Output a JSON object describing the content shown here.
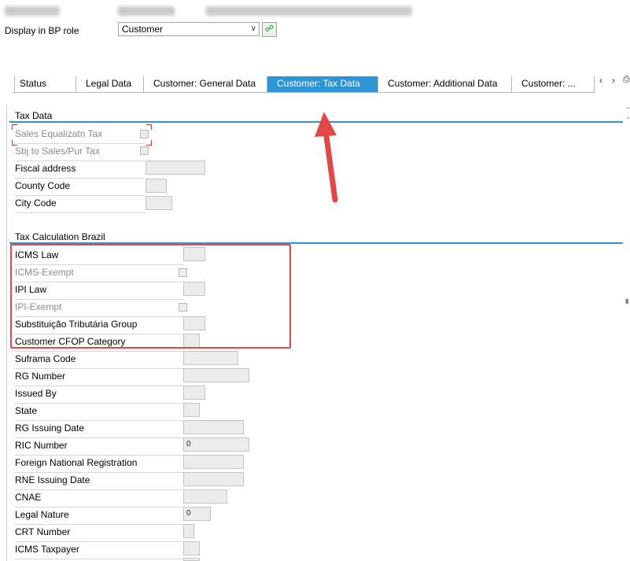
{
  "header": {
    "role_label": "Display in BP role",
    "role_value": "Customer"
  },
  "tabs": [
    {
      "label": "Status",
      "active": false
    },
    {
      "label": "Legal Data",
      "active": false
    },
    {
      "label": "Customer: General Data",
      "active": false
    },
    {
      "label": "Customer: Tax Data",
      "active": true
    },
    {
      "label": "Customer: Additional Data",
      "active": false
    },
    {
      "label": "Customer: ...",
      "active": false
    }
  ],
  "tax_data": {
    "title": "Tax Data",
    "fields": [
      {
        "label": "Sales Equalizatn Tax",
        "type": "checkbox",
        "disabled": true
      },
      {
        "label": "Sbj to Sales/Pur Tax",
        "type": "checkbox",
        "disabled": true
      },
      {
        "label": "Fiscal address",
        "type": "input",
        "value": ""
      },
      {
        "label": "County Code",
        "type": "input",
        "value": ""
      },
      {
        "label": "City Code",
        "type": "input",
        "value": ""
      }
    ]
  },
  "tax_brazil": {
    "title": "Tax Calculation Brazil",
    "fields": [
      {
        "label": "ICMS Law",
        "type": "input",
        "value": ""
      },
      {
        "label": "ICMS-Exempt",
        "type": "checkbox",
        "disabled": true
      },
      {
        "label": "IPI Law",
        "type": "input",
        "value": ""
      },
      {
        "label": "IPI-Exempt",
        "type": "checkbox",
        "disabled": true
      },
      {
        "label": "Substituição Tributária Group",
        "type": "input",
        "value": ""
      },
      {
        "label": "Customer CFOP Category",
        "type": "input",
        "value": ""
      },
      {
        "label": "Suframa Code",
        "type": "input",
        "value": ""
      },
      {
        "label": "RG Number",
        "type": "input",
        "value": ""
      },
      {
        "label": "Issued By",
        "type": "input",
        "value": ""
      },
      {
        "label": "State",
        "type": "input",
        "value": ""
      },
      {
        "label": "RG Issuing Date",
        "type": "input",
        "value": ""
      },
      {
        "label": "RIC Number",
        "type": "input",
        "value": "0"
      },
      {
        "label": "Foreign National Registration",
        "type": "input",
        "value": ""
      },
      {
        "label": "RNE Issuing Date",
        "type": "input",
        "value": ""
      },
      {
        "label": "CNAE",
        "type": "input",
        "value": ""
      },
      {
        "label": "Legal Nature",
        "type": "input",
        "value": "0"
      },
      {
        "label": "CRT Number",
        "type": "input",
        "value": ""
      },
      {
        "label": "ICMS Taxpayer",
        "type": "input",
        "value": ""
      }
    ]
  },
  "annotation": {
    "highlight_color": "#e24848",
    "accent_color": "#2d94d6"
  }
}
